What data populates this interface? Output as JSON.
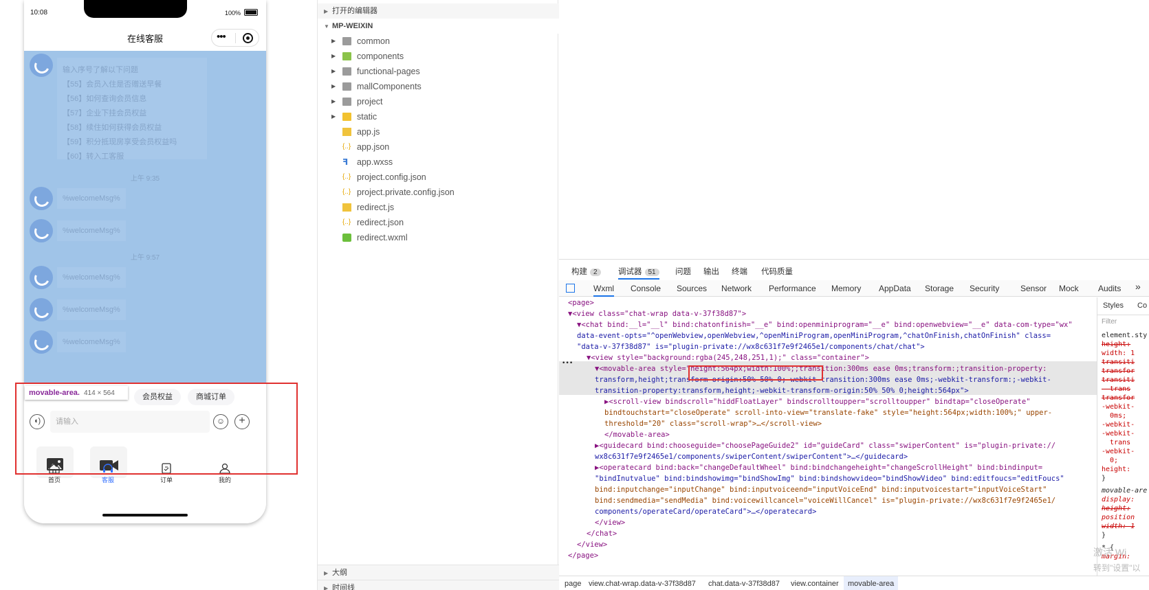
{
  "simulator": {
    "status_time": "10:08",
    "battery_text": "100%",
    "nav_title": "在线客服",
    "capsule_more": "•••",
    "menu_bubble": [
      "输入序号了解以下问题",
      "【55】会员入住是否赠送早餐",
      "【56】如何查询会员信息",
      "【57】企业下挂会员权益",
      "【58】续住如何获得会员权益",
      "【59】积分抵现房享受会员权益吗",
      "【60】转入工客服"
    ],
    "time_1": "上午 9:35",
    "time_2": "上午 9:57",
    "welcome_msg": "%welcomeMsg%",
    "chips": [
      "会员权益",
      "商城订单"
    ],
    "input_placeholder": "请输入",
    "voice_glyph": "◖)",
    "emoji_glyph": "☺",
    "plus_glyph": "+",
    "tooltip_name": "movable-area.",
    "tooltip_size": "414 × 564",
    "tabs": [
      "首页",
      "客服",
      "订单",
      "我的"
    ],
    "accent_color": "#3370ff",
    "highlight_color": "#e0302f"
  },
  "explorer": {
    "open_editors": "打开的编辑器",
    "project_name": "MP-WEIXIN",
    "items": [
      {
        "label": "common",
        "kind": "folder"
      },
      {
        "label": "components",
        "kind": "folder-green"
      },
      {
        "label": "functional-pages",
        "kind": "folder"
      },
      {
        "label": "mallComponents",
        "kind": "folder"
      },
      {
        "label": "project",
        "kind": "folder"
      },
      {
        "label": "static",
        "kind": "folder-yellow"
      },
      {
        "label": "app.js",
        "kind": "js"
      },
      {
        "label": "app.json",
        "kind": "json"
      },
      {
        "label": "app.wxss",
        "kind": "wxss"
      },
      {
        "label": "project.config.json",
        "kind": "json"
      },
      {
        "label": "project.private.config.json",
        "kind": "json"
      },
      {
        "label": "redirect.js",
        "kind": "js"
      },
      {
        "label": "redirect.json",
        "kind": "json"
      },
      {
        "label": "redirect.wxml",
        "kind": "wxml"
      }
    ],
    "outline": "大纲",
    "timeline": "时间线"
  },
  "devtools": {
    "panel_tabs": [
      {
        "label": "构建",
        "badge": "2"
      },
      {
        "label": "调试器",
        "badge": "51"
      },
      {
        "label": "问题",
        "badge": ""
      },
      {
        "label": "输出",
        "badge": ""
      },
      {
        "label": "终端",
        "badge": ""
      },
      {
        "label": "代码质量",
        "badge": ""
      }
    ],
    "tool_tabs": [
      "Wxml",
      "Console",
      "Sources",
      "Network",
      "Performance",
      "Memory",
      "AppData",
      "Storage",
      "Security",
      "Sensor",
      "Mock",
      "Audits"
    ],
    "more_glyph": "»",
    "ellipsis": "•••",
    "code_lines": [
      "<page>",
      "▼<view class=\"chat-wrap data-v-37f38d87\">",
      "▼<chat bind:__l=\"__l\" bind:chatonfinish=\"__e\" bind:openminiprogram=\"__e\" bind:openwebview=\"__e\" data-com-type=\"wx\"",
      "data-event-opts=\"^openWebview,openWebview,^openMiniProgram,openMiniProgram,^chatOnFinish,chatOnFinish\" class=",
      "\"data-v-37f38d87\" is=\"plugin-private://wx8c631f7e9f2465e1/components/chat/chat\">",
      "▼<view style=\"background:rgba(245,248,251,1);\" class=\"container\">",
      "▼<movable-area style=\"height:564px;width:100%;;transition:300ms ease 0ms;transform:;transition-property:",
      "transform,height;transform-origin:50% 50% 0;-webkit-transition:300ms ease 0ms;-webkit-transform:;-webkit-",
      "transition-property:transform,height;-webkit-transform-origin:50% 50% 0;height:564px\">",
      "▶<scroll-view bindscroll=\"hiddFloatLayer\" bindscrolltoupper=\"scrolltoupper\" bindtap=\"closeOperate\"",
      "bindtouchstart=\"closeOperate\" scroll-into-view=\"translate-fake\" style=\"height:564px;width:100%;\" upper-",
      "threshold=\"20\" class=\"scroll-wrap\">…</scroll-view>",
      "</movable-area>",
      "▶<guidecard bind:chooseguide=\"choosePageGuide2\" id=\"guideCard\" class=\"swiperContent\" is=\"plugin-private://",
      "wx8c631f7e9f2465e1/components/swiperContent/swiperContent\">…</guidecard>",
      "▶<operatecard bind:back=\"changeDefaultWheel\" bind:bindchangeheight=\"changeScrollHeight\" bind:bindinput=",
      "\"bindInutvalue\" bind:bindshowimg=\"bindShowImg\" bind:bindshowvideo=\"bindShowVideo\" bind:editfoucs=\"editFoucs\"",
      "bind:inputchange=\"inputChange\" bind:inputvoiceend=\"inputVoiceEnd\" bind:inputvoicestart=\"inputVoiceStart\"",
      "bind:sendmedia=\"sendMedia\" bind:voicewillcancel=\"voiceWillCancel\" is=\"plugin-private://wx8c631f7e9f2465e1/",
      "components/operateCard/operateCard\">…</operatecard>",
      "</view>",
      "</chat>",
      "</view>",
      "</page>"
    ],
    "breadcrumbs": [
      "page",
      "view.chat-wrap.data-v-37f38d87",
      "chat.data-v-37f38d87",
      "view.container",
      "movable-area"
    ],
    "styles_tabs": [
      "Styles",
      "Co"
    ],
    "styles_filter": "Filter",
    "styles_lines": [
      "element.sty",
      "height:",
      "width: 1",
      "transiti",
      "transfor",
      "transiti",
      "  trans",
      "transfor",
      "-webkit-",
      "  0ms;",
      "-webkit-",
      "-webkit-",
      "  trans",
      "-webkit-",
      "  0;",
      "height:",
      "}",
      "movable-are",
      "display:",
      "height:",
      "position",
      "width: 1",
      "}",
      "* {",
      "margin:"
    ],
    "watermark_1": "激活 Wi",
    "watermark_2": "转到\"设置\"以"
  }
}
